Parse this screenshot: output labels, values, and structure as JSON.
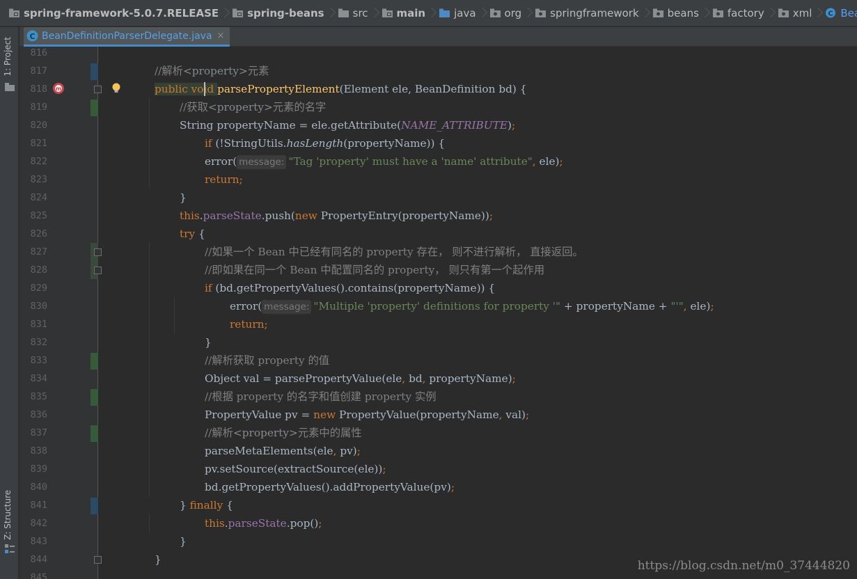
{
  "breadcrumbs": [
    {
      "label": "spring-framework-5.0.7.RELEASE",
      "icon": "project-folder-icon",
      "bold": true
    },
    {
      "label": "spring-beans",
      "icon": "module-folder-icon",
      "bold": true
    },
    {
      "label": "src",
      "icon": "folder-icon",
      "bold": false
    },
    {
      "label": "main",
      "icon": "module-folder-icon",
      "bold": true
    },
    {
      "label": "java",
      "icon": "source-folder-icon",
      "bold": false
    },
    {
      "label": "org",
      "icon": "package-icon",
      "bold": false
    },
    {
      "label": "springframework",
      "icon": "package-icon",
      "bold": false
    },
    {
      "label": "beans",
      "icon": "package-icon",
      "bold": false
    },
    {
      "label": "factory",
      "icon": "package-icon",
      "bold": false
    },
    {
      "label": "xml",
      "icon": "package-icon",
      "bold": false
    },
    {
      "label": "BeanDefinitionParserDelegate",
      "icon": "class-icon",
      "bold": false
    }
  ],
  "tool_windows": {
    "project": "1: Project",
    "structure": "Z: Structure"
  },
  "editor_tab": {
    "label": "BeanDefinitionParserDelegate.java",
    "close": "×",
    "icon": "class-icon"
  },
  "colors": {
    "background": "#2b2b2b",
    "gutter": "#313335",
    "keyword": "#cc7832",
    "comment": "#808080",
    "string": "#6a8759",
    "field": "#9876aa",
    "method_decl": "#ffc66d",
    "text": "#a9b7c6",
    "line_number": "#606366"
  },
  "code": {
    "lines": [
      {
        "n": "816",
        "tokens": []
      },
      {
        "n": "817",
        "tokens": [
          [
            "cm",
            "//解析"
          ],
          [
            "tag",
            "<property>"
          ],
          [
            "cm",
            "元素"
          ]
        ]
      },
      {
        "n": "818",
        "tokens": [
          [
            "kw",
            "public void "
          ],
          [
            "fn",
            "parsePropertyElement"
          ],
          [
            "t",
            "(Element ele, BeanDefinition bd) {"
          ]
        ]
      },
      {
        "n": "819",
        "tokens": [
          [
            "cm",
            "//获取"
          ],
          [
            "tag",
            "<property>"
          ],
          [
            "cm",
            "元素的名字"
          ]
        ]
      },
      {
        "n": "820",
        "tokens": [
          [
            "t",
            "String propertyName = ele.getAttribute("
          ],
          [
            "const",
            "NAME_ATTRIBUTE"
          ],
          [
            "t",
            ")"
          ],
          [
            "kw",
            ";"
          ]
        ]
      },
      {
        "n": "821",
        "tokens": [
          [
            "kw",
            "if "
          ],
          [
            "t",
            "(!StringUtils."
          ],
          [
            "static",
            "hasLength"
          ],
          [
            "t",
            "(propertyName)) {"
          ]
        ]
      },
      {
        "n": "822",
        "tokens": [
          [
            "t",
            "error("
          ],
          [
            "hint",
            "message:"
          ],
          [
            "str",
            "\"Tag 'property' must have a 'name' attribute\""
          ],
          [
            "kw",
            ", "
          ],
          [
            "t",
            "ele)"
          ],
          [
            "kw",
            ";"
          ]
        ]
      },
      {
        "n": "823",
        "tokens": [
          [
            "kw",
            "return;"
          ]
        ]
      },
      {
        "n": "824",
        "tokens": [
          [
            "t",
            "}"
          ]
        ]
      },
      {
        "n": "825",
        "tokens": [
          [
            "kw",
            "this"
          ],
          [
            "t",
            "."
          ],
          [
            "fld",
            "parseState"
          ],
          [
            "t",
            ".push("
          ],
          [
            "kw",
            "new "
          ],
          [
            "t",
            "PropertyEntry(propertyName))"
          ],
          [
            "kw",
            ";"
          ]
        ]
      },
      {
        "n": "826",
        "tokens": [
          [
            "kw",
            "try "
          ],
          [
            "t",
            "{"
          ]
        ]
      },
      {
        "n": "827",
        "tokens": [
          [
            "cm",
            "//如果一个 Bean 中已经有同名的 property 存在， 则不进行解析， 直接返回。"
          ]
        ]
      },
      {
        "n": "828",
        "tokens": [
          [
            "cm",
            "//即如果在同一个 Bean 中配置同名的 property， 则只有第一个起作用"
          ]
        ]
      },
      {
        "n": "829",
        "tokens": [
          [
            "kw",
            "if "
          ],
          [
            "t",
            "(bd.getPropertyValues().contains(propertyName)) {"
          ]
        ]
      },
      {
        "n": "830",
        "tokens": [
          [
            "t",
            "error("
          ],
          [
            "hint",
            "message:"
          ],
          [
            "str",
            "\"Multiple 'property' definitions for property '\" "
          ],
          [
            "t",
            "+ propertyName + "
          ],
          [
            "str",
            "\"'\""
          ],
          [
            "kw",
            ", "
          ],
          [
            "t",
            "ele)"
          ],
          [
            "kw",
            ";"
          ]
        ]
      },
      {
        "n": "831",
        "tokens": [
          [
            "kw",
            "return;"
          ]
        ]
      },
      {
        "n": "832",
        "tokens": [
          [
            "t",
            "}"
          ]
        ]
      },
      {
        "n": "833",
        "tokens": [
          [
            "cm",
            "//解析获取 property 的值"
          ]
        ]
      },
      {
        "n": "834",
        "tokens": [
          [
            "t",
            "Object val = parsePropertyValue(ele"
          ],
          [
            "kw",
            ", "
          ],
          [
            "t",
            "bd"
          ],
          [
            "kw",
            ", "
          ],
          [
            "t",
            "propertyName)"
          ],
          [
            "kw",
            ";"
          ]
        ]
      },
      {
        "n": "835",
        "tokens": [
          [
            "cm",
            "//根据 property 的名字和值创建 property 实例"
          ]
        ]
      },
      {
        "n": "836",
        "tokens": [
          [
            "t",
            "PropertyValue pv = "
          ],
          [
            "kw",
            "new "
          ],
          [
            "t",
            "PropertyValue(propertyName"
          ],
          [
            "kw",
            ", "
          ],
          [
            "t",
            "val)"
          ],
          [
            "kw",
            ";"
          ]
        ]
      },
      {
        "n": "837",
        "tokens": [
          [
            "cm",
            "//解析"
          ],
          [
            "tag",
            "<property>"
          ],
          [
            "cm",
            "元素中的属性"
          ]
        ]
      },
      {
        "n": "838",
        "tokens": [
          [
            "t",
            "parseMetaElements(ele"
          ],
          [
            "kw",
            ", "
          ],
          [
            "t",
            "pv)"
          ],
          [
            "kw",
            ";"
          ]
        ]
      },
      {
        "n": "839",
        "tokens": [
          [
            "t",
            "pv.setSource(extractSource(ele))"
          ],
          [
            "kw",
            ";"
          ]
        ]
      },
      {
        "n": "840",
        "tokens": [
          [
            "t",
            "bd.getPropertyValues().addPropertyValue(pv)"
          ],
          [
            "kw",
            ";"
          ]
        ]
      },
      {
        "n": "841",
        "tokens": [
          [
            "t",
            "} "
          ],
          [
            "kw",
            "finally "
          ],
          [
            "t",
            "{"
          ]
        ]
      },
      {
        "n": "842",
        "tokens": [
          [
            "kw",
            "this"
          ],
          [
            "t",
            "."
          ],
          [
            "fld",
            "parseState"
          ],
          [
            "t",
            ".pop()"
          ],
          [
            "kw",
            ";"
          ]
        ]
      },
      {
        "n": "843",
        "tokens": [
          [
            "t",
            "}"
          ]
        ]
      },
      {
        "n": "844",
        "tokens": [
          [
            "t",
            "}"
          ]
        ]
      },
      {
        "n": "845",
        "tokens": []
      }
    ]
  },
  "watermark": "https://blog.csdn.net/m0_37444820"
}
